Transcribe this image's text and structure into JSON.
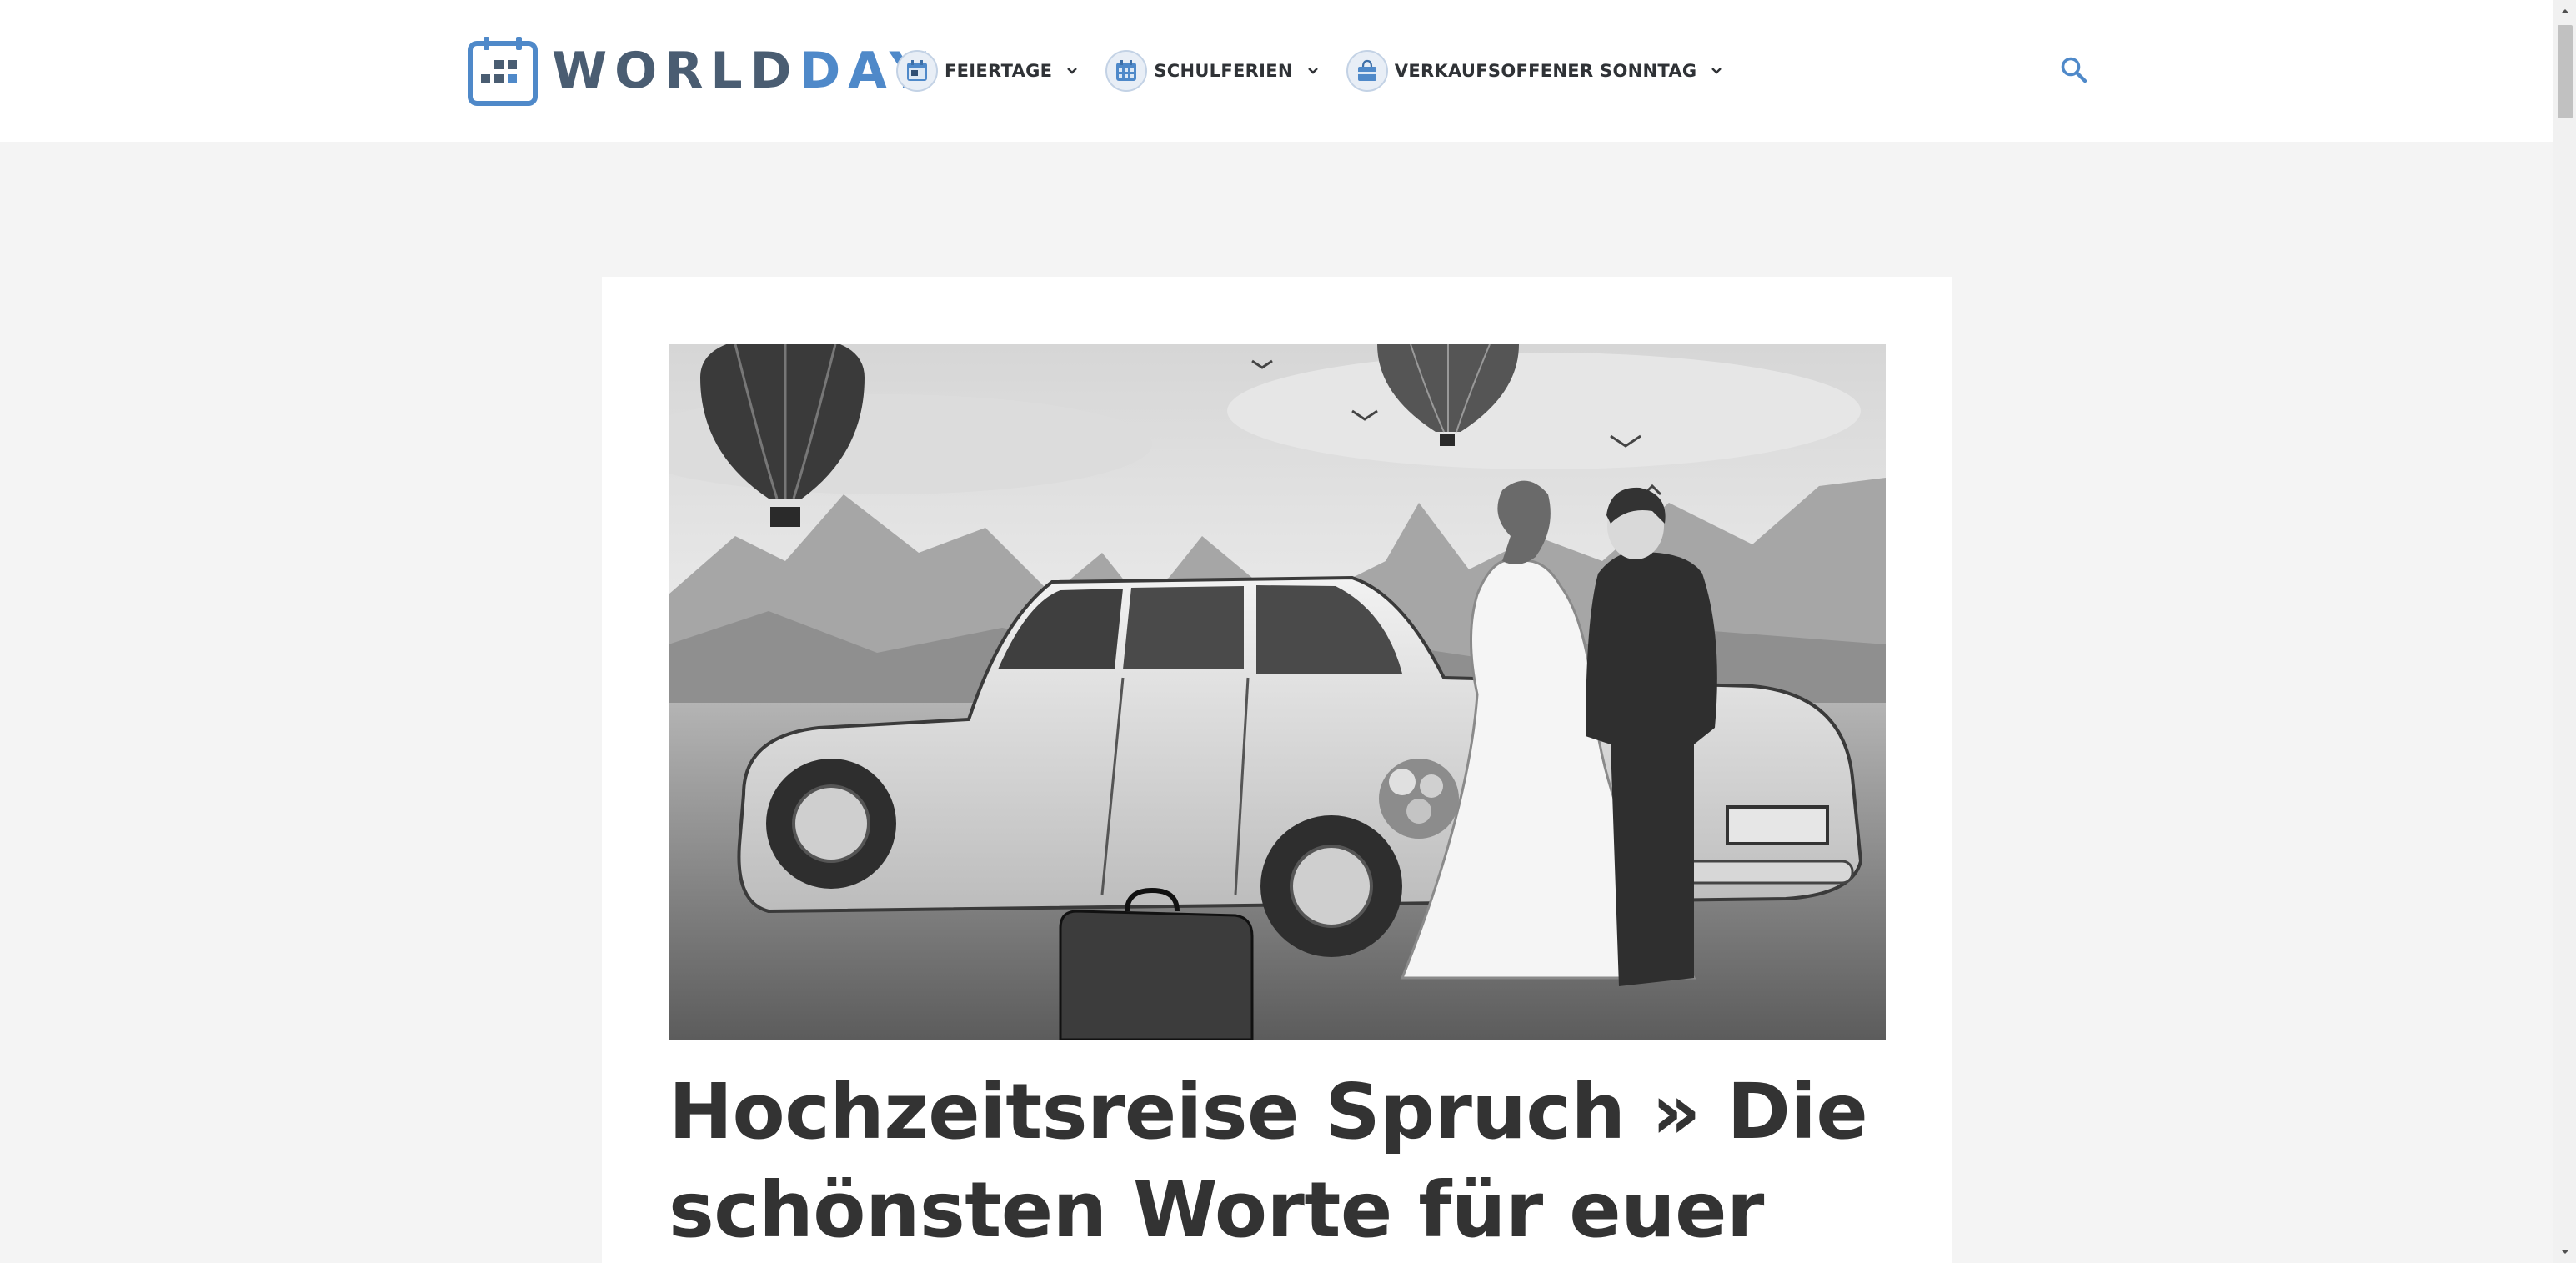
{
  "site": {
    "logo_world": "WORLD",
    "logo_day": "DAY",
    "logo_icon": "calendar-icon"
  },
  "nav": {
    "items": [
      {
        "label": "FEIERTAGE",
        "icon": "calendar-day-icon"
      },
      {
        "label": "SCHULFERIEN",
        "icon": "calendar-grid-icon"
      },
      {
        "label": "VERKAUFSOFFENER SONNTAG",
        "icon": "shopping-bag-icon"
      }
    ],
    "search_icon": "search-icon"
  },
  "colors": {
    "brand_dark": "#4a5d72",
    "brand_blue": "#4f89c9",
    "page_bg": "#f4f4f4",
    "title": "#333333"
  },
  "article": {
    "title": "Hochzeitsreise Spruch » Die schönsten Worte für euer"
  }
}
